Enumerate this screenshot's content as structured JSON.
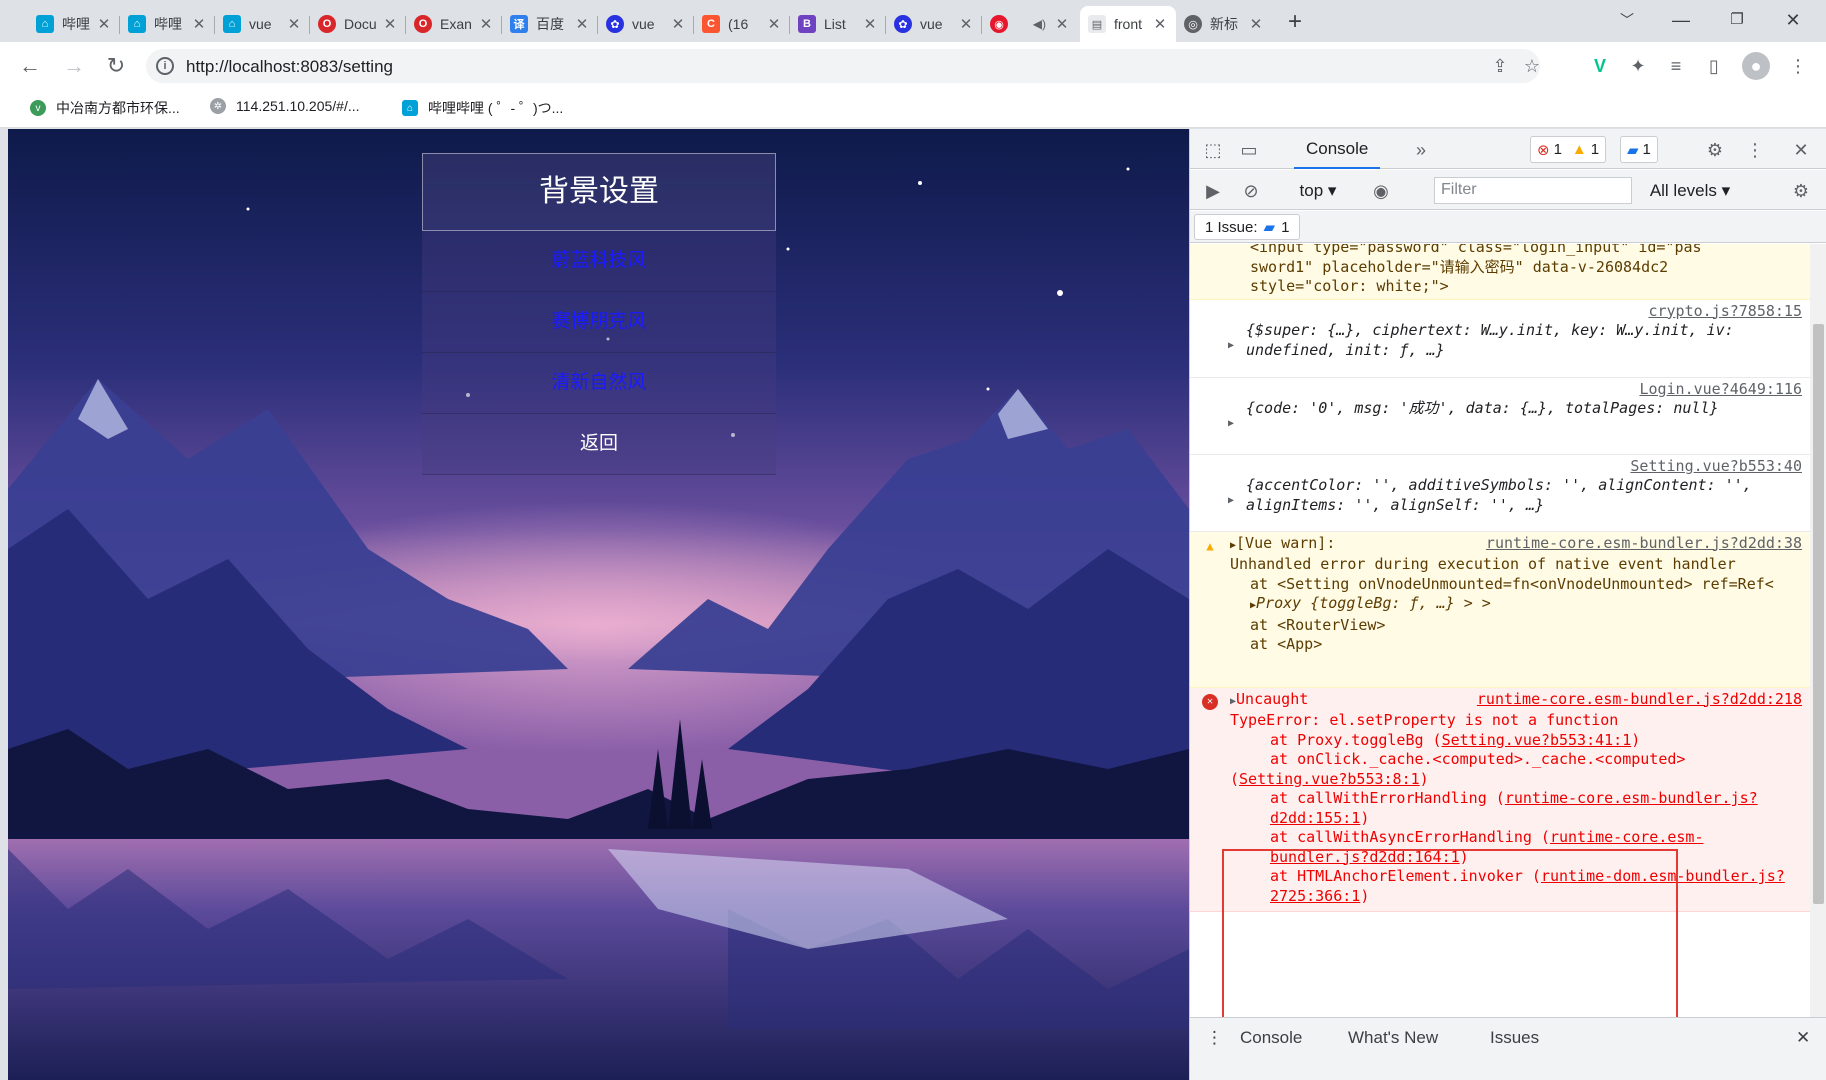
{
  "tabs": [
    {
      "title": "哔哩",
      "icon": "bilibili-icon",
      "color": "#00a1d6"
    },
    {
      "title": "哔哩",
      "icon": "bilibili-icon",
      "color": "#00a1d6"
    },
    {
      "title": "vue",
      "icon": "bilibili-icon",
      "color": "#00a1d6"
    },
    {
      "title": "Docu",
      "icon": "opera-icon",
      "color": "#d9262b"
    },
    {
      "title": "Exan",
      "icon": "opera-icon",
      "color": "#d9262b"
    },
    {
      "title": "百度",
      "icon": "translate-icon",
      "color": "#2f80ed"
    },
    {
      "title": "vue",
      "icon": "baidu-paw-icon",
      "color": "#2932e1"
    },
    {
      "title": "(16",
      "icon": "csdn-icon",
      "color": "#fc5531"
    },
    {
      "title": "List",
      "icon": "bootstrap-icon",
      "color": "#6f42c1"
    },
    {
      "title": "vue",
      "icon": "baidu-paw-icon",
      "color": "#2932e1"
    },
    {
      "title": "",
      "icon": "weibo-icon",
      "color": "#e6162d"
    },
    {
      "title": "front",
      "icon": "page-icon",
      "color": "#5f6368"
    },
    {
      "title": "新标",
      "icon": "chrome-icon",
      "color": "#5f6368"
    }
  ],
  "address": {
    "url": "http://localhost:8083/setting"
  },
  "bookmarks": [
    {
      "label": "中冶南方都市环保...",
      "color": "#3c9b5a"
    },
    {
      "label": "114.251.10.205/#/...",
      "color": "#9aa0a6"
    },
    {
      "label": "哔哩哔哩 ( ゜- ゜)つ...",
      "color": "#00a1d6"
    }
  ],
  "page": {
    "title": "背景设置",
    "options": [
      "蔚蓝科技风",
      "赛博朋克风",
      "清新自然风"
    ],
    "back": "返回"
  },
  "devtools": {
    "tab": "Console",
    "more": "»",
    "errors": "1",
    "warnings": "1",
    "messages": "1",
    "context": "top",
    "filter_placeholder": "Filter",
    "levels": "All levels",
    "issues_label": "1 Issue:",
    "issues_count": "1",
    "drawer_tabs": [
      "Console",
      "What's New",
      "Issues"
    ],
    "log": {
      "elem_line1": "<input type=\"password\" class=\"login_input\" id=\"pas",
      "elem_line2": "sword1\" placeholder=\"请输入密码\" data-v-26084dc2",
      "elem_line3": "style=\"color: white;\">",
      "crypto_src": "crypto.js?7858:15",
      "crypto_obj": "{$super: {…}, ciphertext: W…y.init, key: W…y.init, iv: undefined, init: ƒ, …}",
      "login_src": "Login.vue?4649:116",
      "login_obj": "{code: '0', msg: '成功', data: {…}, totalPages: null}",
      "setting_src": "Setting.vue?b553:40",
      "setting_obj": "{accentColor: '', additiveSymbols: '', alignContent: '', alignItems: '', alignSelf: '', …}",
      "warn_src": "runtime-core.esm-bundler.js?d2dd:38",
      "warn_head": "[Vue warn]:",
      "warn_body": "Unhandled error during execution of native event handler",
      "warn_at1": "at <Setting onVnodeUnmounted=fn<onVnodeUnmounted> ref=Ref<",
      "warn_proxy": "Proxy {toggleBg: ƒ, …} > >",
      "warn_at2": "at <RouterView>",
      "warn_at3": "at <App>",
      "err_src": "runtime-core.esm-bundler.js?d2dd:218",
      "err_head": "Uncaught",
      "err_type": "TypeError: el.setProperty is not a function",
      "err_at1": "at Proxy.toggleBg (",
      "err_at1_link": "Setting.vue?b553:41:1",
      "err_at2": "at onClick._cache.<computed>._cache.<computed>",
      "err_at2_link": "Setting.vue?b553:8:1",
      "err_at3": "at callWithErrorHandling (",
      "err_at3_link": "runtime-core.esm-bundler.js?d2dd:155:1",
      "err_at4": "at callWithAsyncErrorHandling (",
      "err_at4_link": "runtime-core.esm-bundler.js?d2dd:164:1",
      "err_at5": "at HTMLAnchorElement.invoker (",
      "err_at5_link": "runtime-dom.esm-bundler.js?2725:366:1"
    }
  }
}
